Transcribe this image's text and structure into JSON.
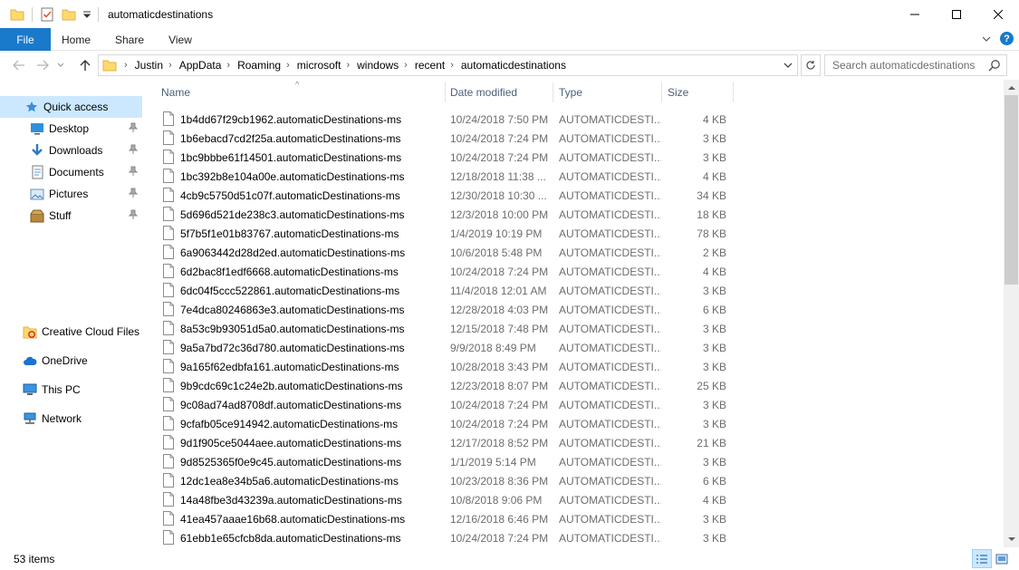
{
  "window": {
    "title": "automaticdestinations"
  },
  "ribbon": {
    "tabs": [
      "File",
      "Home",
      "Share",
      "View"
    ]
  },
  "address": {
    "crumbs": [
      "Justin",
      "AppData",
      "Roaming",
      "microsoft",
      "windows",
      "recent",
      "automaticdestinations"
    ]
  },
  "search": {
    "placeholder": "Search automaticdestinations"
  },
  "nav": {
    "quick_access": "Quick access",
    "pinned": [
      "Desktop",
      "Downloads",
      "Documents",
      "Pictures",
      "Stuff"
    ],
    "creative_cloud": "Creative Cloud Files",
    "onedrive": "OneDrive",
    "this_pc": "This PC",
    "network": "Network"
  },
  "columns": {
    "name": "Name",
    "date": "Date modified",
    "type": "Type",
    "size": "Size"
  },
  "files": [
    [
      "1b4dd67f29cb1962.automaticDestinations-ms",
      "10/24/2018 7:50 PM",
      "AUTOMATICDESTI...",
      "4 KB"
    ],
    [
      "1b6ebacd7cd2f25a.automaticDestinations-ms",
      "10/24/2018 7:24 PM",
      "AUTOMATICDESTI...",
      "3 KB"
    ],
    [
      "1bc9bbbe61f14501.automaticDestinations-ms",
      "10/24/2018 7:24 PM",
      "AUTOMATICDESTI...",
      "3 KB"
    ],
    [
      "1bc392b8e104a00e.automaticDestinations-ms",
      "12/18/2018 11:38 ...",
      "AUTOMATICDESTI...",
      "4 KB"
    ],
    [
      "4cb9c5750d51c07f.automaticDestinations-ms",
      "12/30/2018 10:30 ...",
      "AUTOMATICDESTI...",
      "34 KB"
    ],
    [
      "5d696d521de238c3.automaticDestinations-ms",
      "12/3/2018 10:00 PM",
      "AUTOMATICDESTI...",
      "18 KB"
    ],
    [
      "5f7b5f1e01b83767.automaticDestinations-ms",
      "1/4/2019 10:19 PM",
      "AUTOMATICDESTI...",
      "78 KB"
    ],
    [
      "6a9063442d28d2ed.automaticDestinations-ms",
      "10/6/2018 5:48 PM",
      "AUTOMATICDESTI...",
      "2 KB"
    ],
    [
      "6d2bac8f1edf6668.automaticDestinations-ms",
      "10/24/2018 7:24 PM",
      "AUTOMATICDESTI...",
      "4 KB"
    ],
    [
      "6dc04f5ccc522861.automaticDestinations-ms",
      "11/4/2018 12:01 AM",
      "AUTOMATICDESTI...",
      "3 KB"
    ],
    [
      "7e4dca80246863e3.automaticDestinations-ms",
      "12/28/2018 4:03 PM",
      "AUTOMATICDESTI...",
      "6 KB"
    ],
    [
      "8a53c9b93051d5a0.automaticDestinations-ms",
      "12/15/2018 7:48 PM",
      "AUTOMATICDESTI...",
      "3 KB"
    ],
    [
      "9a5a7bd72c36d780.automaticDestinations-ms",
      "9/9/2018 8:49 PM",
      "AUTOMATICDESTI...",
      "3 KB"
    ],
    [
      "9a165f62edbfa161.automaticDestinations-ms",
      "10/28/2018 3:43 PM",
      "AUTOMATICDESTI...",
      "3 KB"
    ],
    [
      "9b9cdc69c1c24e2b.automaticDestinations-ms",
      "12/23/2018 8:07 PM",
      "AUTOMATICDESTI...",
      "25 KB"
    ],
    [
      "9c08ad74ad8708df.automaticDestinations-ms",
      "10/24/2018 7:24 PM",
      "AUTOMATICDESTI...",
      "3 KB"
    ],
    [
      "9cfafb05ce914942.automaticDestinations-ms",
      "10/24/2018 7:24 PM",
      "AUTOMATICDESTI...",
      "3 KB"
    ],
    [
      "9d1f905ce5044aee.automaticDestinations-ms",
      "12/17/2018 8:52 PM",
      "AUTOMATICDESTI...",
      "21 KB"
    ],
    [
      "9d8525365f0e9c45.automaticDestinations-ms",
      "1/1/2019 5:14 PM",
      "AUTOMATICDESTI...",
      "3 KB"
    ],
    [
      "12dc1ea8e34b5a6.automaticDestinations-ms",
      "10/23/2018 8:36 PM",
      "AUTOMATICDESTI...",
      "6 KB"
    ],
    [
      "14a48fbe3d43239a.automaticDestinations-ms",
      "10/8/2018 9:06 PM",
      "AUTOMATICDESTI...",
      "4 KB"
    ],
    [
      "41ea457aaae16b68.automaticDestinations-ms",
      "12/16/2018 6:46 PM",
      "AUTOMATICDESTI...",
      "3 KB"
    ],
    [
      "61ebb1e65cfcb8da.automaticDestinations-ms",
      "10/24/2018 7:24 PM",
      "AUTOMATICDESTI...",
      "3 KB"
    ]
  ],
  "status": {
    "count": "53 items"
  },
  "colors": {
    "accent": "#1979ca",
    "selection": "#cce8ff",
    "header_text": "#4c607a",
    "muted_text": "#6d6d6d"
  }
}
